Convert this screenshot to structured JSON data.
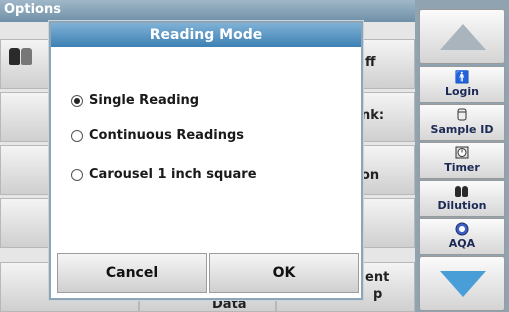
{
  "screen": {
    "title": "Options",
    "cells": {
      "row1_right": "ff",
      "row2_right": "nk:",
      "row3_right": "on",
      "row6_right_line1": "ent",
      "row6_right_line2": "p",
      "row6_mid": "Data"
    }
  },
  "dialog": {
    "title": "Reading Mode",
    "options": [
      {
        "label": "Single Reading",
        "selected": true
      },
      {
        "label": "Continuous Readings",
        "selected": false
      },
      {
        "label": "Carousel 1 inch square",
        "selected": false
      }
    ],
    "cancel_label": "Cancel",
    "ok_label": "OK"
  },
  "sidebar": {
    "items": [
      {
        "label": "Login",
        "icon": "person-icon"
      },
      {
        "label": "Sample ID",
        "icon": "vial-icon"
      },
      {
        "label": "Timer",
        "icon": "timer-icon"
      },
      {
        "label": "Dilution",
        "icon": "dilution-icon"
      },
      {
        "label": "AQA",
        "icon": "aqa-icon"
      }
    ]
  },
  "colors": {
    "dialog_title_bg": "#3d80b4",
    "arrow_up": "#a9b4bc",
    "arrow_down": "#4a9ed8"
  }
}
